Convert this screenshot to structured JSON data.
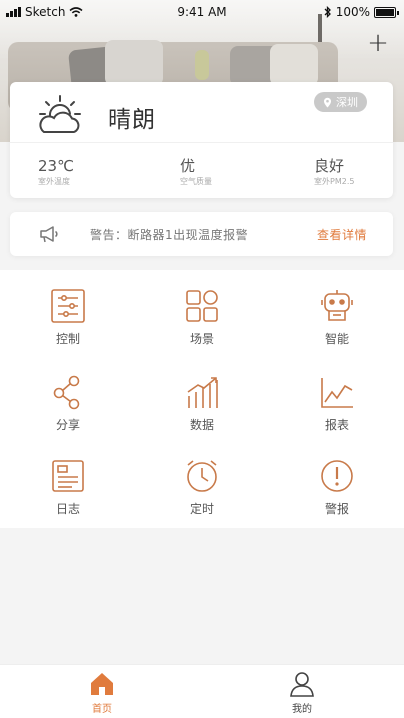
{
  "status_bar": {
    "carrier": "Sketch",
    "time": "9:41 AM",
    "battery": "100%"
  },
  "weather": {
    "condition": "晴朗",
    "location": "深圳",
    "metrics": [
      {
        "value": "23℃",
        "label": "室外温度"
      },
      {
        "value": "优",
        "label": "空气质量"
      },
      {
        "value": "良好",
        "label": "室外PM2.5"
      }
    ]
  },
  "alert": {
    "message": "警告：断路器1出现温度报警",
    "link": "查看详情"
  },
  "grid": [
    {
      "label": "控制",
      "icon": "sliders-icon"
    },
    {
      "label": "场景",
      "icon": "scenes-grid-icon"
    },
    {
      "label": "智能",
      "icon": "robot-icon"
    },
    {
      "label": "分享",
      "icon": "share-icon"
    },
    {
      "label": "数据",
      "icon": "bar-chart-icon"
    },
    {
      "label": "报表",
      "icon": "line-chart-icon"
    },
    {
      "label": "日志",
      "icon": "log-icon"
    },
    {
      "label": "定时",
      "icon": "clock-icon"
    },
    {
      "label": "警报",
      "icon": "alert-icon"
    }
  ],
  "tabs": [
    {
      "label": "首页",
      "icon": "home-icon",
      "active": true
    },
    {
      "label": "我的",
      "icon": "person-icon",
      "active": false
    }
  ],
  "colors": {
    "accent": "#e07b3d",
    "text": "#333333",
    "muted": "#aaaaaa"
  }
}
